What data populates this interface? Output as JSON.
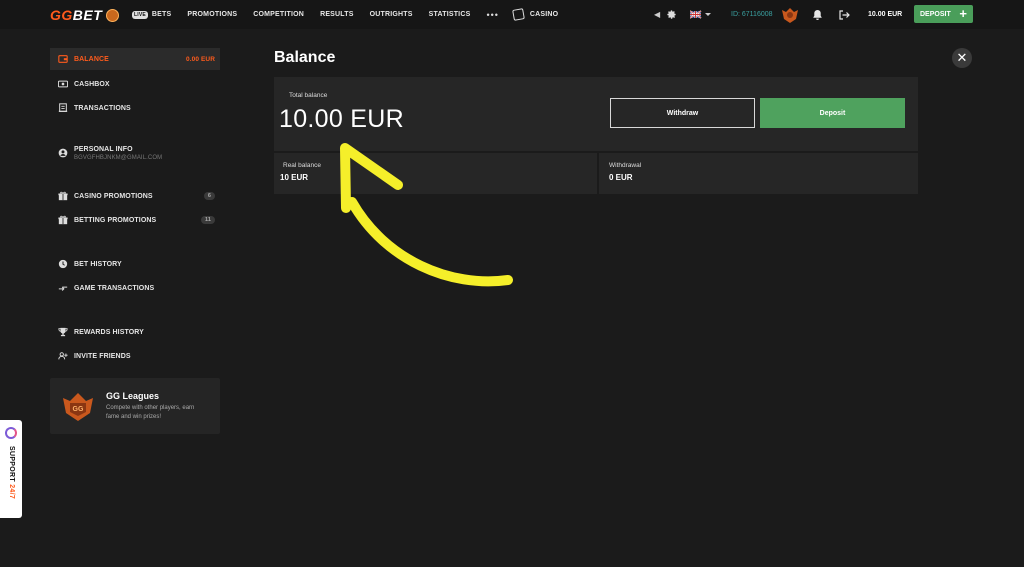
{
  "header": {
    "logo": {
      "gg": "GG",
      "bet": "BET"
    },
    "nav": [
      {
        "pill": "LIVE",
        "label": "BETS"
      },
      {
        "label": "PROMOTIONS"
      },
      {
        "label": "COMPETITION"
      },
      {
        "label": "RESULTS"
      },
      {
        "label": "OUTRIGHTS"
      },
      {
        "label": "STATISTICS"
      }
    ],
    "more": "•••",
    "casino": "CASINO",
    "user_id": "ID: 67116008",
    "balance": "10.00 EUR",
    "deposit": "DEPOSIT",
    "deposit_plus": "+"
  },
  "sidebar": {
    "items": [
      {
        "label": "BALANCE",
        "value": "0.00 EUR",
        "icon": "wallet-icon",
        "active": true
      },
      {
        "label": "CASHBOX",
        "icon": "cash-icon"
      },
      {
        "label": "TRANSACTIONS",
        "icon": "receipt-icon"
      },
      {
        "label": "PERSONAL INFO",
        "sub": "BGVGFHBJNKM@GMAIL.COM",
        "icon": "user-icon"
      },
      {
        "label": "CASINO PROMOTIONS",
        "count": "6",
        "icon": "gift-icon"
      },
      {
        "label": "BETTING PROMOTIONS",
        "count": "11",
        "icon": "gift-icon"
      },
      {
        "label": "BET HISTORY",
        "icon": "clock-icon"
      },
      {
        "label": "GAME TRANSACTIONS",
        "icon": "swap-icon"
      },
      {
        "label": "REWARDS HISTORY",
        "icon": "trophy-icon"
      },
      {
        "label": "INVITE FRIENDS",
        "icon": "add-user-icon"
      }
    ],
    "gg_leagues": {
      "title": "GG Leagues",
      "desc": "Compete with other players, earn fame and win prizes!"
    }
  },
  "main": {
    "title": "Balance",
    "close": "✕",
    "total_label": "Total balance",
    "total_value": "10.00 EUR",
    "withdraw": "Withdraw",
    "deposit": "Deposit",
    "real_label": "Real balance",
    "real_value": "10 EUR",
    "withdrawal_label": "Withdrawal",
    "withdrawal_value": "0 EUR"
  },
  "support": {
    "label": "SUPPORT",
    "hours": "24/7"
  },
  "colors": {
    "accent": "#ff5b1c",
    "deposit_green": "#4fa25e",
    "arrow_yellow": "#f5ef2a"
  }
}
